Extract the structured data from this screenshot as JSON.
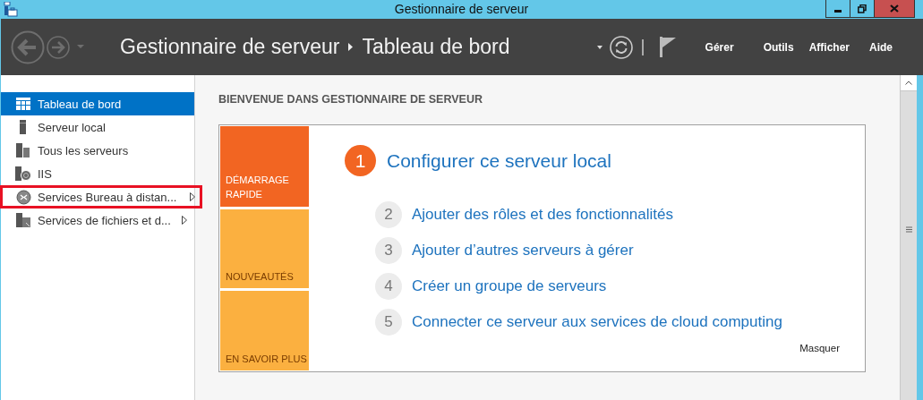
{
  "window": {
    "title": "Gestionnaire de serveur"
  },
  "header": {
    "breadcrumb": [
      "Gestionnaire de serveur",
      "Tableau de bord"
    ],
    "menus": [
      "Gérer",
      "Outils",
      "Afficher",
      "Aide"
    ]
  },
  "sidebar": {
    "items": [
      {
        "label": "Tableau de bord",
        "kind": "dashboard",
        "selected": true,
        "expandable": false,
        "highlighted": false
      },
      {
        "label": "Serveur local",
        "kind": "server",
        "selected": false,
        "expandable": false,
        "highlighted": false
      },
      {
        "label": "Tous les serveurs",
        "kind": "servers",
        "selected": false,
        "expandable": false,
        "highlighted": false
      },
      {
        "label": "IIS",
        "kind": "iis",
        "selected": false,
        "expandable": false,
        "highlighted": false
      },
      {
        "label": "Services Bureau à distan...",
        "kind": "remote",
        "selected": false,
        "expandable": true,
        "highlighted": true
      },
      {
        "label": "Services de fichiers et d...",
        "kind": "files",
        "selected": false,
        "expandable": true,
        "highlighted": false
      }
    ]
  },
  "dashboard": {
    "heading": "BIENVENUE DANS GESTIONNAIRE DE SERVEUR",
    "tiles": [
      {
        "label": "DÉMARRAGE RAPIDE",
        "selected": true
      },
      {
        "label": "NOUVEAUTÉS",
        "selected": false
      },
      {
        "label": "EN SAVOIR PLUS",
        "selected": false
      }
    ],
    "steps": [
      {
        "number": "1",
        "label": "Configurer ce serveur local",
        "kind": "primary"
      },
      {
        "number": "2",
        "label": "Ajouter des rôles et des fonctionnalités",
        "kind": "secondary"
      },
      {
        "number": "3",
        "label": "Ajouter d’autres serveurs à gérer",
        "kind": "secondary"
      },
      {
        "number": "4",
        "label": "Créer un groupe de serveurs",
        "kind": "secondary"
      },
      {
        "number": "5",
        "label": "Connecter ce serveur aux services de cloud computing",
        "kind": "secondary"
      }
    ],
    "hide_link": "Masquer"
  }
}
